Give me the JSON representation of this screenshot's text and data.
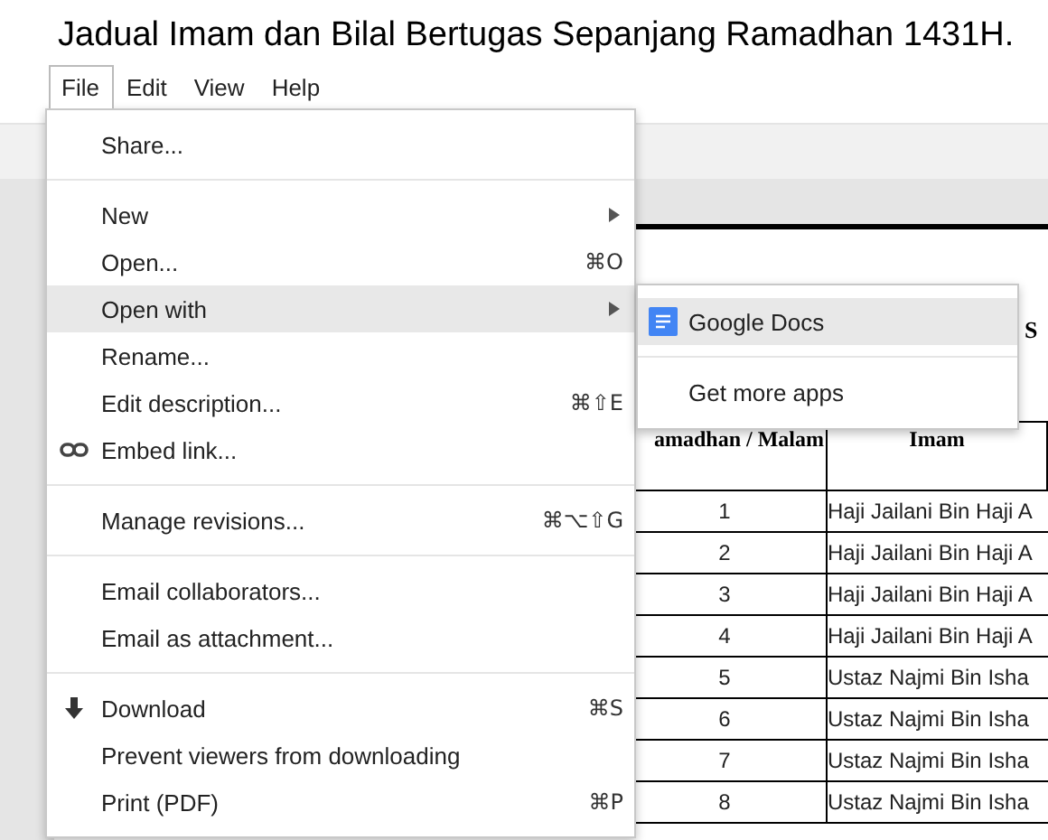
{
  "title": "Jadual Imam dan Bilal Bertugas Sepanjang Ramadhan 1431H.",
  "menubar": [
    {
      "label": "File",
      "selected": true
    },
    {
      "label": "Edit",
      "selected": false
    },
    {
      "label": "View",
      "selected": false
    },
    {
      "label": "Help",
      "selected": false
    }
  ],
  "file_menu": [
    {
      "kind": "item",
      "label": "Share...",
      "selected": false
    },
    {
      "kind": "separator"
    },
    {
      "kind": "item",
      "label": "New",
      "submenu": true,
      "selected": false
    },
    {
      "kind": "item",
      "label": "Open...",
      "shortcut": "⌘O",
      "selected": false
    },
    {
      "kind": "item",
      "label": "Open with",
      "submenu": true,
      "selected": true
    },
    {
      "kind": "item",
      "label": "Rename...",
      "selected": false
    },
    {
      "kind": "item",
      "label": "Edit description...",
      "shortcut": "⌘⇧E",
      "selected": false
    },
    {
      "kind": "link-item",
      "label": "Embed link...",
      "selected": false
    },
    {
      "kind": "separator"
    },
    {
      "kind": "item",
      "label": "Manage revisions...",
      "shortcut": "⌘⌥⇧G",
      "selected": false
    },
    {
      "kind": "separator"
    },
    {
      "kind": "item",
      "label": "Email collaborators...",
      "selected": false
    },
    {
      "kind": "item",
      "label": "Email as attachment...",
      "selected": false
    },
    {
      "kind": "separator"
    },
    {
      "kind": "download-item",
      "label": "Download",
      "shortcut": "⌘S",
      "selected": false
    },
    {
      "kind": "item",
      "label": "Prevent viewers from downloading",
      "selected": false
    },
    {
      "kind": "item",
      "label": "Print (PDF)",
      "shortcut": "⌘P",
      "selected": false
    }
  ],
  "open_with_submenu": [
    {
      "kind": "app-item",
      "label": "Google Docs",
      "selected": true
    },
    {
      "kind": "separator"
    },
    {
      "kind": "item",
      "label": "Get more apps",
      "selected": false
    }
  ],
  "document": {
    "heading": "S",
    "table": {
      "columns": [
        "amadhan / Malam",
        "Imam"
      ],
      "rows": [
        [
          "1",
          "Haji Jailani Bin Haji A"
        ],
        [
          "2",
          "Haji Jailani Bin Haji A"
        ],
        [
          "3",
          "Haji Jailani Bin Haji A"
        ],
        [
          "4",
          "Haji Jailani Bin Haji A"
        ],
        [
          "5",
          "Ustaz Najmi Bin Isha"
        ],
        [
          "6",
          "Ustaz Najmi Bin Isha"
        ],
        [
          "7",
          "Ustaz Najmi Bin Isha"
        ],
        [
          "8",
          "Ustaz Najmi Bin Isha"
        ]
      ]
    }
  }
}
